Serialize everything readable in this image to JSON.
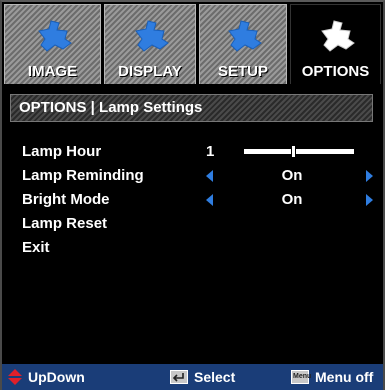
{
  "tabs": [
    {
      "label": "IMAGE",
      "icon": "puzzle-icon",
      "active": false
    },
    {
      "label": "DISPLAY",
      "icon": "puzzle-icon",
      "active": false
    },
    {
      "label": "SETUP",
      "icon": "puzzle-icon",
      "active": false
    },
    {
      "label": "OPTIONS",
      "icon": "puzzle-icon",
      "active": true
    }
  ],
  "breadcrumb": "OPTIONS | Lamp Settings",
  "menu": {
    "lamp_hour": {
      "label": "Lamp Hour",
      "value": "1",
      "level": 0.45
    },
    "lamp_reminding": {
      "label": "Lamp Reminding",
      "value": "On"
    },
    "bright_mode": {
      "label": "Bright Mode",
      "value": "On"
    },
    "lamp_reset": {
      "label": "Lamp Reset"
    },
    "exit": {
      "label": "Exit"
    }
  },
  "footer": {
    "updown": "UpDown",
    "select": "Select",
    "menu_off": "Menu off",
    "menu_key": "Menu"
  },
  "colors": {
    "accent_blue": "#2f7de0",
    "footer_bg": "#1a3d78",
    "updown_red": "#e0202a"
  }
}
